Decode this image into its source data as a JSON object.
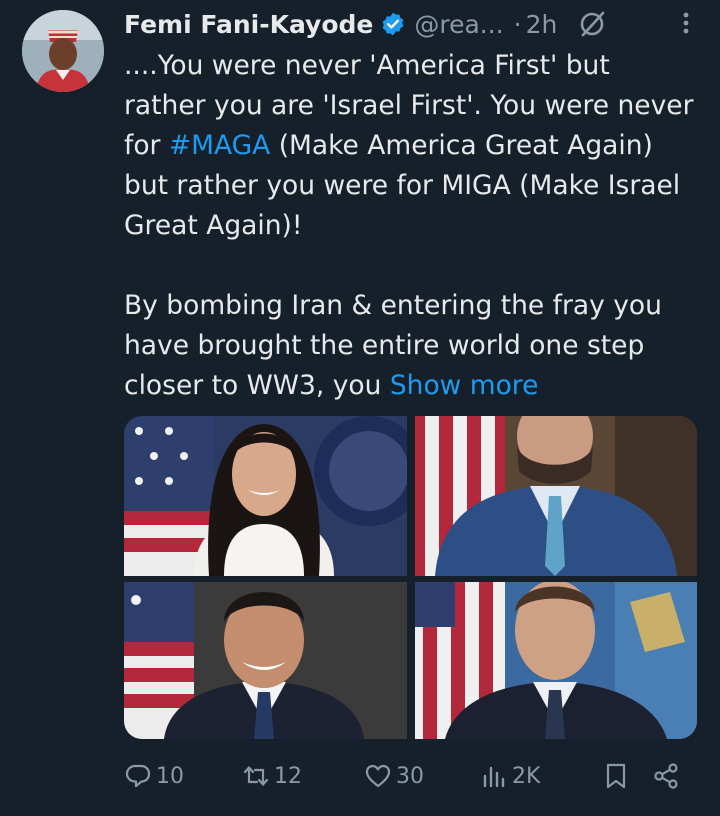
{
  "tweet": {
    "author_name": "Femi Fani-Kayode",
    "handle": "@rea...",
    "separator": "·",
    "time": "2h",
    "body_p1_a": "....You were never 'America First' but rather you are 'Israel First'.  You were never for ",
    "hashtag": "#MAGA",
    "body_p1_b": " (Make America Great Again) but rather you were for MIGA (Make Israel Great Again)!",
    "body_p2": "By bombing Iran & entering the fray  you have brought the entire world one step closer to WW3, you ",
    "show_more": "Show more"
  },
  "actions": {
    "replies": "10",
    "reposts": "12",
    "likes": "30",
    "views": "2K"
  },
  "icons": {
    "verified": "verified-badge-icon",
    "grok": "grok-icon",
    "more": "more-vertical-icon",
    "reply": "reply-icon",
    "repost": "repost-icon",
    "like": "heart-icon",
    "views": "views-chart-icon",
    "bookmark": "bookmark-icon",
    "share": "share-icon"
  },
  "colors": {
    "background": "#15202b",
    "text": "#e7e9ea",
    "muted": "#8b98a5",
    "link": "#1d9bf0"
  }
}
